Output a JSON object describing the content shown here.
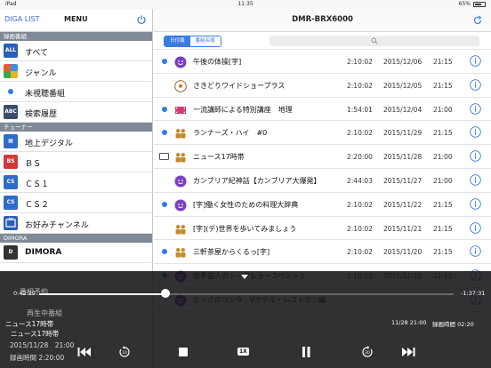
{
  "status": {
    "device": "iPad",
    "time": "11:35",
    "battery": "65%",
    "battery_level": 0.65
  },
  "sidebar": {
    "brand": "DIGA LIST",
    "title": "MENU",
    "sections": [
      {
        "label": "録画番組",
        "items": [
          {
            "label": "すべて",
            "icon": "all-icon"
          },
          {
            "label": "ジャンル",
            "icon": "genre-icon"
          },
          {
            "label": "未視聴番組",
            "icon": "unwatched-dot-icon"
          },
          {
            "label": "検索履歴",
            "icon": "search-history-icon"
          }
        ]
      },
      {
        "label": "チューナー",
        "items": [
          {
            "label": "地上デジタル",
            "icon": "terrestrial-icon"
          },
          {
            "label": "ＢＳ",
            "icon": "bs-icon"
          },
          {
            "label": "ＣＳ１",
            "icon": "cs1-icon"
          },
          {
            "label": "ＣＳ２",
            "icon": "cs2-icon"
          },
          {
            "label": "お好みチャンネル",
            "icon": "favorite-channel-icon"
          }
        ]
      },
      {
        "label": "DIMORA",
        "items": [
          {
            "label": "DIMORA",
            "icon": "dimora-icon"
          }
        ]
      }
    ],
    "hidden_items": [
      "番組予約",
      "再生中番組"
    ]
  },
  "main": {
    "title": "DMR-BRX6000",
    "tabs": [
      "日付順",
      "番組名順"
    ],
    "rows": [
      {
        "title": "午後の体操[字]",
        "duration": "2:10:02",
        "date": "2015/12/06",
        "time": "21:15",
        "dot": true,
        "rec": false,
        "genre": "purple-face"
      },
      {
        "title": "さきどりワイドショープラス",
        "duration": "2:10:02",
        "date": "2015/12/05",
        "time": "21:15",
        "dot": false,
        "rec": false,
        "genre": "soccer-ball"
      },
      {
        "title": "一流講師による特別講座　地理",
        "duration": "1:54:01",
        "date": "2015/12/04",
        "time": "21:00",
        "dot": true,
        "rec": false,
        "genre": "film"
      },
      {
        "title": "ランナーズ・ハイ　#0",
        "duration": "2:10:02",
        "date": "2015/11/29",
        "time": "21:15",
        "dot": true,
        "rec": false,
        "genre": "people"
      },
      {
        "title": "ニュース17時帯",
        "duration": "2:20:00",
        "date": "2015/11/28",
        "time": "21:00",
        "dot": false,
        "rec": true,
        "genre": "people"
      },
      {
        "title": "カンブリア紀神話【カンブリア大爆発】",
        "duration": "2:44:03",
        "date": "2015/11/27",
        "time": "21:00",
        "dot": false,
        "rec": false,
        "genre": "purple-face"
      },
      {
        "title": "[字]働く女性のための料理大辞典",
        "duration": "2:10:02",
        "date": "2015/11/22",
        "time": "21:15",
        "dot": true,
        "rec": false,
        "genre": "purple-face"
      },
      {
        "title": "[字](デ)世界を歩いてみましょう",
        "duration": "2:10:02",
        "date": "2015/11/21",
        "time": "21:15",
        "dot": false,
        "rec": false,
        "genre": "people"
      },
      {
        "title": "三軒茶屋からくるっ[字]",
        "duration": "2:10:02",
        "date": "2015/11/20",
        "time": "21:15",
        "dot": true,
        "rec": false,
        "genre": "people"
      },
      {
        "title": "若手芸人のトークショースペシャル",
        "duration": "2:10:02",
        "date": "2015/11/15",
        "time": "21:15",
        "dot": true,
        "rec": false,
        "genre": "purple-face"
      },
      {
        "title": "とっさのハンタ　Vホテル・レストラン編",
        "duration": "",
        "date": "",
        "time": "",
        "dot": false,
        "rec": false,
        "genre": "purple-face"
      }
    ]
  },
  "player": {
    "elapsed": "0:42:29",
    "remaining": "-1:37:31",
    "progress": 0.305,
    "title_line1": "ニュース17時帯",
    "title_line2": "ニュース17時帯",
    "date": "2015/11/28　21:00",
    "recording_time": "録画時間 2:20:00",
    "right_date": "11/28 21:00",
    "right_recording": "録画時間 02:20",
    "speed": "1X",
    "skip_back_seconds": "10",
    "skip_forward_seconds": "30"
  },
  "colors": {
    "accent": "#3a7be0",
    "section": "#7f8a96",
    "dot": "#2f7de1"
  }
}
